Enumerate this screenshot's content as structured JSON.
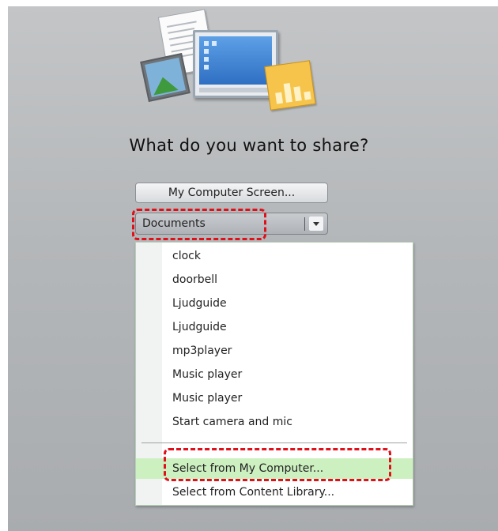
{
  "dialog": {
    "title": "What do you want to share?",
    "screen_button_label": "My Computer Screen...",
    "share_type_select": {
      "selected": "Documents"
    }
  },
  "dropdown": {
    "items": [
      {
        "label": "clock"
      },
      {
        "label": "doorbell"
      },
      {
        "label": "Ljudguide"
      },
      {
        "label": "Ljudguide"
      },
      {
        "label": "mp3player"
      },
      {
        "label": "Music player"
      },
      {
        "label": "Music player"
      },
      {
        "label": "Start camera and mic"
      }
    ],
    "actions": [
      {
        "label": "Select from My Computer...",
        "highlighted": true
      },
      {
        "label": "Select from Content Library...",
        "highlighted": false
      }
    ]
  },
  "colors": {
    "highlight": "#cdf0c0",
    "annotation": "#e0101a",
    "panel": "#b4b7b9"
  },
  "icons": [
    "share-illustration-icon",
    "dropdown-arrow-icon"
  ]
}
